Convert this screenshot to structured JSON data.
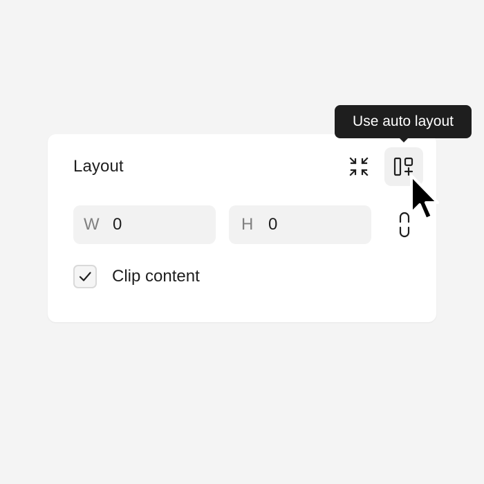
{
  "layout_panel": {
    "title": "Layout",
    "collapse_icon": "collapse-arrows-icon",
    "auto_layout_icon": "auto-layout-icon",
    "width": {
      "label": "W",
      "value": "0"
    },
    "height": {
      "label": "H",
      "value": "0"
    },
    "constrain_icon": "link-icon",
    "clip_content": {
      "label": "Clip content",
      "checked": true
    }
  },
  "tooltip": {
    "text": "Use auto layout"
  },
  "colors": {
    "background": "#f4f4f4",
    "panel": "#ffffff",
    "field": "#f2f2f2",
    "text": "#1e1e1e",
    "muted": "#808080",
    "tooltip": "#1e1e1e"
  }
}
